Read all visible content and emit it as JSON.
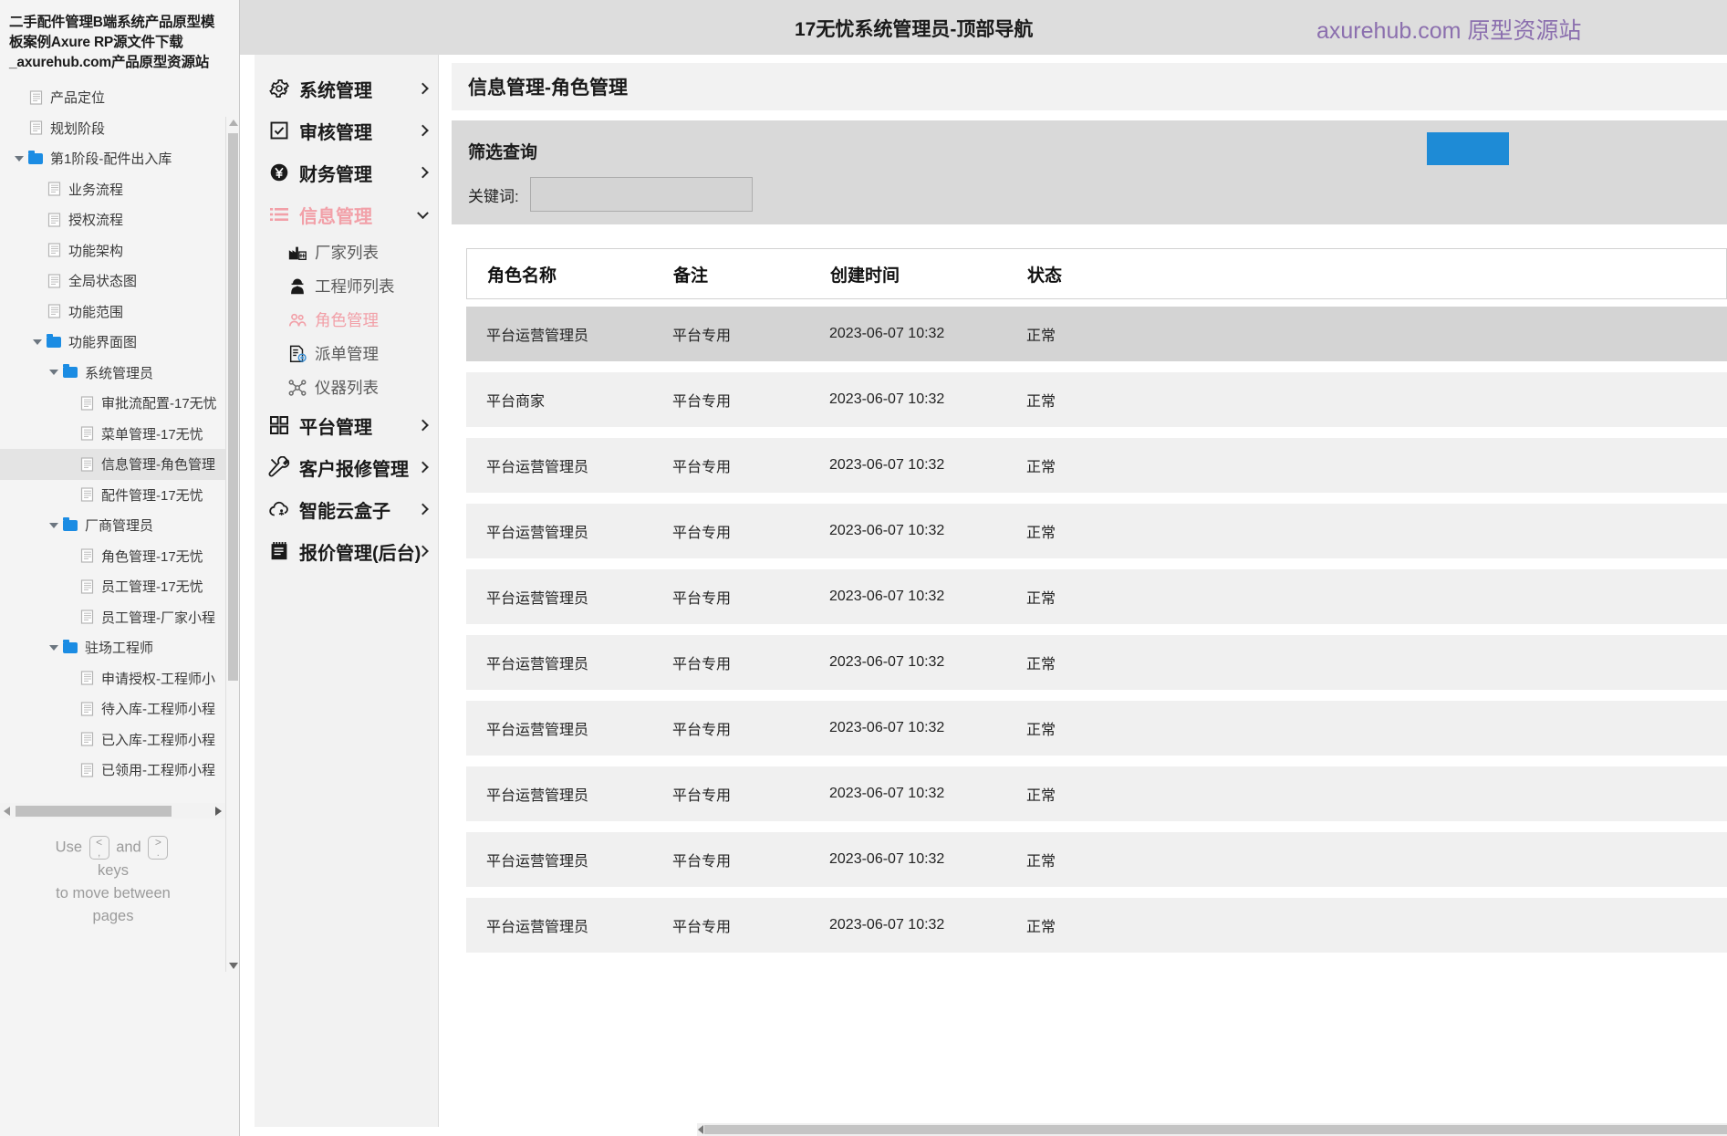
{
  "sitemap": {
    "title": "二手配件管理B端系统产品原型模板案例Axure RP源文件下载_axurehub.com产品原型资源站",
    "nodes": [
      {
        "label": "产品定位",
        "type": "page",
        "depth": 0,
        "caret": false,
        "selected": false
      },
      {
        "label": "规划阶段",
        "type": "page",
        "depth": 0,
        "caret": false,
        "selected": false
      },
      {
        "label": "第1阶段-配件出入库",
        "type": "folder",
        "depth": 0,
        "caret": true,
        "selected": false
      },
      {
        "label": "业务流程",
        "type": "page",
        "depth": 1,
        "caret": false,
        "selected": false
      },
      {
        "label": "授权流程",
        "type": "page",
        "depth": 1,
        "caret": false,
        "selected": false
      },
      {
        "label": "功能架构",
        "type": "page",
        "depth": 1,
        "caret": false,
        "selected": false
      },
      {
        "label": "全局状态图",
        "type": "page",
        "depth": 1,
        "caret": false,
        "selected": false
      },
      {
        "label": "功能范围",
        "type": "page",
        "depth": 1,
        "caret": false,
        "selected": false
      },
      {
        "label": "功能界面图",
        "type": "folder",
        "depth": 1,
        "caret": true,
        "selected": false
      },
      {
        "label": "系统管理员",
        "type": "folder",
        "depth": 2,
        "caret": true,
        "selected": false
      },
      {
        "label": "审批流配置-17无忧",
        "type": "page",
        "depth": 3,
        "caret": false,
        "selected": false
      },
      {
        "label": "菜单管理-17无忧",
        "type": "page",
        "depth": 3,
        "caret": false,
        "selected": false
      },
      {
        "label": "信息管理-角色管理",
        "type": "page",
        "depth": 3,
        "caret": false,
        "selected": true
      },
      {
        "label": "配件管理-17无忧",
        "type": "page",
        "depth": 3,
        "caret": false,
        "selected": false
      },
      {
        "label": "厂商管理员",
        "type": "folder",
        "depth": 2,
        "caret": true,
        "selected": false
      },
      {
        "label": "角色管理-17无忧",
        "type": "page",
        "depth": 3,
        "caret": false,
        "selected": false
      },
      {
        "label": "员工管理-17无忧",
        "type": "page",
        "depth": 3,
        "caret": false,
        "selected": false
      },
      {
        "label": "员工管理-厂家小程",
        "type": "page",
        "depth": 3,
        "caret": false,
        "selected": false
      },
      {
        "label": "驻场工程师",
        "type": "folder",
        "depth": 2,
        "caret": true,
        "selected": false
      },
      {
        "label": "申请授权-工程师小",
        "type": "page",
        "depth": 3,
        "caret": false,
        "selected": false
      },
      {
        "label": "待入库-工程师小程",
        "type": "page",
        "depth": 3,
        "caret": false,
        "selected": false
      },
      {
        "label": "已入库-工程师小程",
        "type": "page",
        "depth": 3,
        "caret": false,
        "selected": false
      },
      {
        "label": "已领用-工程师小程",
        "type": "page",
        "depth": 3,
        "caret": false,
        "selected": false
      }
    ],
    "hint": {
      "use": "Use",
      "and": "and",
      "keys": "keys",
      "move": "to move between",
      "pages": "pages",
      "key_prev_top": "<",
      "key_prev_bottom": ",",
      "key_next_top": ">",
      "key_next_bottom": "."
    }
  },
  "header": {
    "title": "17无忧系统管理员-顶部导航",
    "brand": "axurehub.com 原型资源站",
    "brand_color": "#8b6fae"
  },
  "nav": {
    "items": [
      {
        "label": "系统管理",
        "icon": "gear-icon",
        "active": false,
        "chevron": "right"
      },
      {
        "label": "审核管理",
        "icon": "checkbox-icon",
        "active": false,
        "chevron": "right"
      },
      {
        "label": "财务管理",
        "icon": "yen-circle-icon",
        "active": false,
        "chevron": "right"
      },
      {
        "label": "信息管理",
        "icon": "list-icon",
        "active": true,
        "chevron": "down"
      }
    ],
    "subitems": [
      {
        "label": "厂家列表",
        "icon": "factory-icon",
        "active": false
      },
      {
        "label": "工程师列表",
        "icon": "engineer-icon",
        "active": false
      },
      {
        "label": "角色管理",
        "icon": "users-icon",
        "active": true
      },
      {
        "label": "派单管理",
        "icon": "dispatch-doc-icon",
        "active": false
      },
      {
        "label": "仪器列表",
        "icon": "nodes-icon",
        "active": false
      }
    ],
    "items_bottom": [
      {
        "label": "平台管理",
        "icon": "grid-icon",
        "active": false,
        "chevron": "right"
      },
      {
        "label": "客户报修管理",
        "icon": "wrench-icon",
        "active": false,
        "chevron": "right"
      },
      {
        "label": "智能云盒子",
        "icon": "cloud-icon",
        "active": false,
        "chevron": "right"
      },
      {
        "label": "报价管理(后台)",
        "icon": "notepad-icon",
        "active": false,
        "chevron": "right"
      }
    ]
  },
  "main": {
    "page_title": "信息管理-角色管理",
    "filter": {
      "title": "筛选查询",
      "keyword_label": "关键词:",
      "keyword_value": "",
      "keyword_placeholder": "",
      "search_button_label": "",
      "search_button_color": "#1e8bd6"
    },
    "table": {
      "columns": [
        "角色名称",
        "备注",
        "创建时间",
        "状态"
      ],
      "rows": [
        {
          "name": "平台运营管理员",
          "note": "平台专用",
          "time": "2023-06-07  10:32",
          "status": "正常",
          "selected": true
        },
        {
          "name": "平台商家",
          "note": "平台专用",
          "time": "2023-06-07  10:32",
          "status": "正常",
          "selected": false
        },
        {
          "name": "平台运营管理员",
          "note": "平台专用",
          "time": "2023-06-07  10:32",
          "status": "正常",
          "selected": false
        },
        {
          "name": "平台运营管理员",
          "note": "平台专用",
          "time": "2023-06-07  10:32",
          "status": "正常",
          "selected": false
        },
        {
          "name": "平台运营管理员",
          "note": "平台专用",
          "time": "2023-06-07  10:32",
          "status": "正常",
          "selected": false
        },
        {
          "name": "平台运营管理员",
          "note": "平台专用",
          "time": "2023-06-07  10:32",
          "status": "正常",
          "selected": false
        },
        {
          "name": "平台运营管理员",
          "note": "平台专用",
          "time": "2023-06-07  10:32",
          "status": "正常",
          "selected": false
        },
        {
          "name": "平台运营管理员",
          "note": "平台专用",
          "time": "2023-06-07  10:32",
          "status": "正常",
          "selected": false
        },
        {
          "name": "平台运营管理员",
          "note": "平台专用",
          "time": "2023-06-07  10:32",
          "status": "正常",
          "selected": false
        },
        {
          "name": "平台运营管理员",
          "note": "平台专用",
          "time": "2023-06-07  10:32",
          "status": "正常",
          "selected": false
        }
      ]
    }
  }
}
